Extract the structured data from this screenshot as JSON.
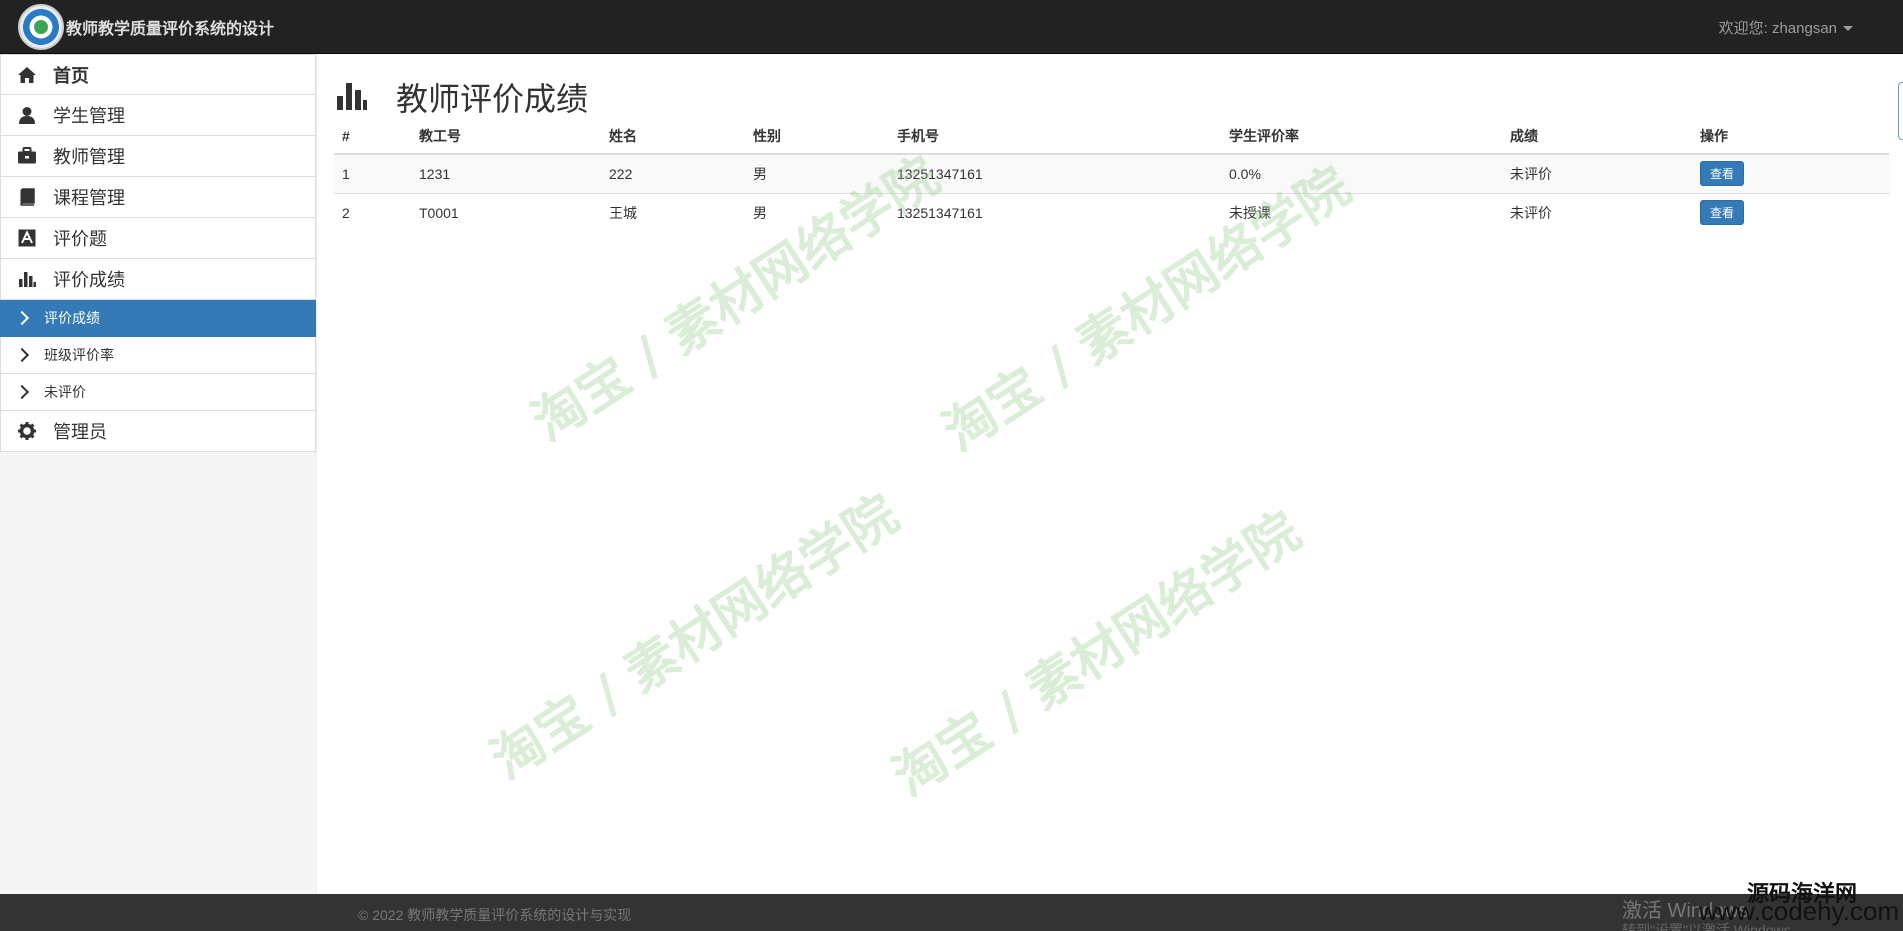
{
  "app": {
    "title": "教师教学质量评价系统的设计"
  },
  "user": {
    "greeting": "欢迎您: zhangsan"
  },
  "sidebar": {
    "items": [
      {
        "label": "首页",
        "icon": "home-icon"
      },
      {
        "label": "学生管理",
        "icon": "user-icon"
      },
      {
        "label": "教师管理",
        "icon": "briefcase-icon"
      },
      {
        "label": "课程管理",
        "icon": "book-icon"
      },
      {
        "label": "评价题",
        "icon": "font-icon"
      },
      {
        "label": "评价成绩",
        "icon": "stats-icon"
      }
    ],
    "sub_items": [
      {
        "label": "评价成绩",
        "active": true
      },
      {
        "label": "班级评价率",
        "active": false
      },
      {
        "label": "未评价",
        "active": false
      }
    ],
    "admin": {
      "label": "管理员",
      "icon": "cog-icon"
    }
  },
  "main": {
    "title": "教师评价成绩",
    "columns": [
      "#",
      "教工号",
      "姓名",
      "性别",
      "手机号",
      "学生评价率",
      "成绩",
      "操作"
    ],
    "rows": [
      {
        "idx": "1",
        "id": "1231",
        "name": "222",
        "gender": "男",
        "phone": "13251347161",
        "rate": "0.0%",
        "score": "未评价",
        "action": "查看"
      },
      {
        "idx": "2",
        "id": "T0001",
        "name": "王城",
        "gender": "男",
        "phone": "13251347161",
        "rate": "未授课",
        "score": "未评价",
        "action": "查看"
      }
    ]
  },
  "watermark": "淘宝 / 素材网络学院",
  "footer": {
    "copyright": "© 2022 教师教学质量评价系统的设计与实现",
    "win_activate": "激活 Windows",
    "win_activate_sub": "转到\"设置\"以激活 Windows。",
    "site_name": "源码海洋网",
    "site_url": "www.codehy.com"
  },
  "colors": {
    "navbar": "#222222",
    "active": "#337ab7",
    "footer": "#333333"
  }
}
